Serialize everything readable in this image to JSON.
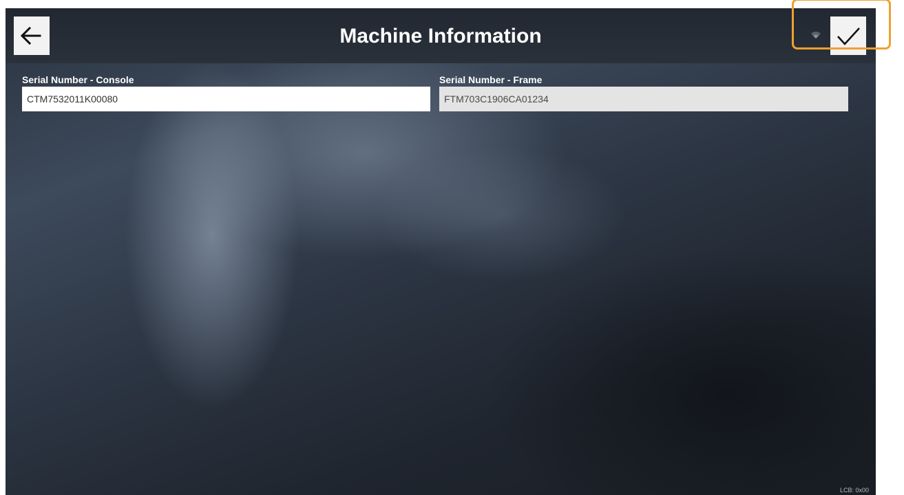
{
  "header": {
    "title": "Machine Information",
    "back_icon": "arrow-left-icon",
    "wifi_icon": "wifi-icon",
    "confirm_icon": "checkmark-icon",
    "highlight_color": "#f0a030"
  },
  "fields": {
    "console": {
      "label": "Serial Number - Console",
      "value": "CTM7532011K00080"
    },
    "frame": {
      "label": "Serial Number - Frame",
      "value": "FTM703C1906CA01234"
    }
  },
  "footer": {
    "code": "LCB: 0x00"
  }
}
